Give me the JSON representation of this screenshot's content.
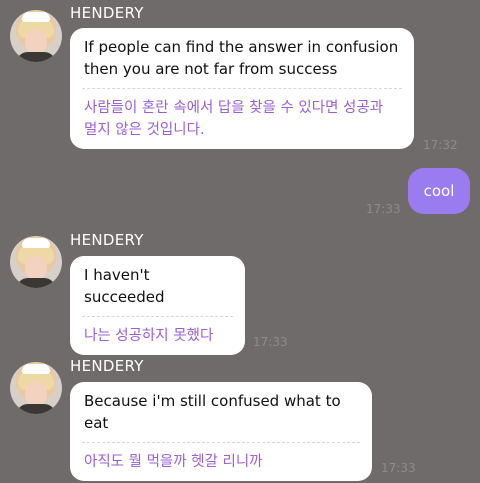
{
  "messages": [
    {
      "sender": "HENDERY",
      "english": "If people can find the answer in confusion then you are not far from success",
      "korean": "사람들이 혼란 속에서 답을 찾을 수 있다면 성공과 멀지 않은 것입니다.",
      "time": "17:32"
    },
    {
      "sender": "me",
      "text": "cool",
      "time": "17:33"
    },
    {
      "sender": "HENDERY",
      "english": "I haven't succeeded",
      "korean": "나는 성공하지 못했다",
      "time": "17:33"
    },
    {
      "sender": "HENDERY",
      "english": "Because i'm still confused what to eat",
      "korean": "아직도 뭘 먹을까 헷갈 리니까",
      "time": "17:33"
    }
  ],
  "colors": {
    "background": "#6f6b6a",
    "bubble": "#ffffff",
    "translation_text": "#9b5fd6",
    "my_bubble": "#9b7cf0",
    "timestamp": "#8f8b89"
  },
  "icons": {
    "avatar": "profile-photo"
  }
}
